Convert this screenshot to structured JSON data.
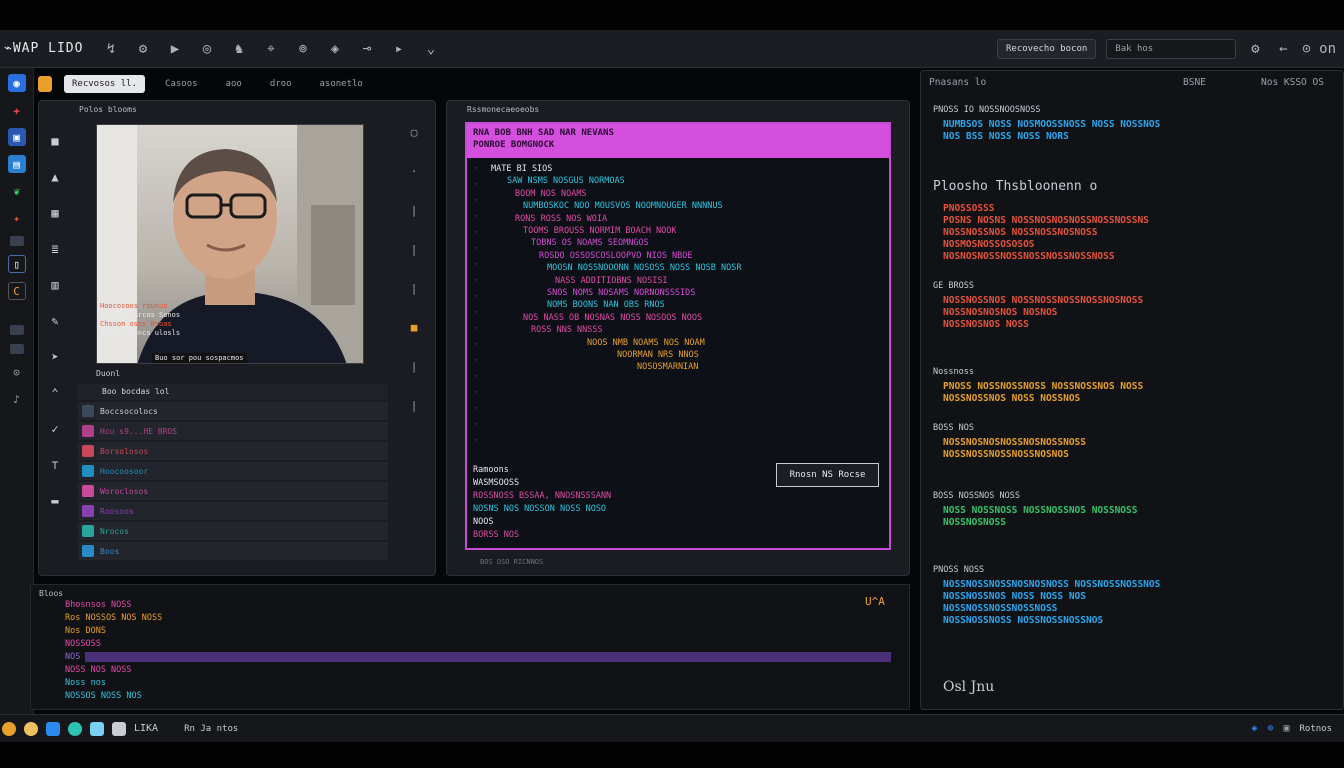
{
  "window": {
    "brand": "⌁WAP LIDO"
  },
  "menubar": {
    "tools": [
      "↯",
      "⚙",
      "▶",
      "◎",
      "♞",
      "⌖",
      "⊚",
      "◈",
      "⊸",
      "▸",
      "⌄"
    ],
    "right_button": "Recovecho bocon",
    "search_placeholder": "Bak hos",
    "right_icons": [
      "⚙",
      "←",
      "⊙ on"
    ]
  },
  "tabs": [
    {
      "label": "Recvosos ll.",
      "active": true
    },
    {
      "label": "Casoos",
      "active": false
    },
    {
      "label": "aoo",
      "active": false
    },
    {
      "label": "droo",
      "active": false
    },
    {
      "label": "asonetlo",
      "active": false
    }
  ],
  "left_panel": {
    "title": "Polos blooms",
    "caption": [
      "Hoocosoos rounuo",
      "Gnoosne Rrcos Sonos",
      "Chsson osns Bsoas",
      "Snmsos Boncs ulosls"
    ],
    "caption_bar": "Buo sor pou sospacmos",
    "status": "Duonl",
    "subheader": "Boo bocdas lol",
    "rows": [
      {
        "label": "Boccsocolocs",
        "color": "#3a4a5c"
      },
      {
        "label": "Hcu s9...HE BROS",
        "color": "#b23f8a"
      },
      {
        "label": "Borsolosos",
        "color": "#c9485a"
      },
      {
        "label": "Hoocoosoor",
        "color": "#1f8fbf"
      },
      {
        "label": "Woroclosos",
        "color": "#c94a9a"
      },
      {
        "label": "Roosoos",
        "color": "#8a3fb2"
      },
      {
        "label": "Nrocos",
        "color": "#2aa59a"
      },
      {
        "label": "Boos",
        "color": "#2a8ac9"
      }
    ]
  },
  "editor": {
    "title": "Rssmonecaeoeobs",
    "head": [
      "RNA BOB BNH SAD NAR NEVANS",
      "PONROE BOMGNOCK"
    ],
    "lines": [
      {
        "t": "MATE BI SIOS",
        "c": "#e6e8ec"
      },
      {
        "t": "SAW NSMS   NOSGUS NORMOAS",
        "c": "#2ec4e0"
      },
      {
        "t": "BOOM NOS  NOAMS",
        "c": "#e24aa8"
      },
      {
        "t": "NUMBOSKOC  NOO  MOUSVOS  NOOMNOUGER NNNNUS",
        "c": "#2ec4e0"
      },
      {
        "t": "RONS ROSS  NOS WOIA",
        "c": "#e24aa8"
      },
      {
        "t": "TOOMS BROUSS NORMIM BOACH NOOK",
        "c": "#e24aa8"
      },
      {
        "t": "TOBNS OS NOAMS SEOMNGOS",
        "c": "#d84ad8"
      },
      {
        "t": "ROSDO OSSOSCOSLOOPVO NIOS NBOE",
        "c": "#d84ad8"
      },
      {
        "t": "MOOSN NOSSNOOONN NOSOSS NOSS NOSB NOSR",
        "c": "#2ec4e0"
      },
      {
        "t": "NASS  ADDITIOBNS NOSISI",
        "c": "#e24aa8"
      },
      {
        "t": "SNOS NOMS NOSAMS NORNONSSSIDS",
        "c": "#d84ad8"
      },
      {
        "t": "NOMS BOONS NAN OBS   RNOS",
        "c": "#2ec4e0"
      },
      {
        "t": "NOS NASS OB  NOSNAS NOSS NOSOOS NOOS",
        "c": "#e24aa8"
      },
      {
        "t": "ROSS NNS NNSSS",
        "c": "#e24aa8"
      },
      {
        "t": "NOOS NMB NOAMS NOS NOAM",
        "c": "#e8a02a"
      },
      {
        "t": "NOORMAN NRS NNOS",
        "c": "#e8a02a"
      },
      {
        "t": "NOSOSMARNIAN",
        "c": "#e8a02a"
      }
    ],
    "footer": [
      "Ramoons",
      "WASMSOOSS",
      "ROSSNOSS BSSAA, NNOSNSSSANN",
      "NOSNS NOS NOSSON NOSS NOSO",
      "NOOS",
      "BORSS NOS"
    ],
    "dialog": "Rnosn NS Rocse",
    "status": "BOS OSO RICNNOS"
  },
  "right_panel": {
    "header_left": "Pnasans lo",
    "header_right": [
      "BSNE",
      "Nos KSSO OS"
    ],
    "sections": [
      {
        "title": "PNOSS  IO NOSSNOOSNOSS",
        "lines": [
          "NUMBSOS NOSS NOSMOOSSNOSS NOSS NOSSNOS",
          "NOS BSS NOSS NOSS NORS"
        ],
        "color": "#2aa8f0"
      },
      {
        "title": "Ploosho Thsbloonenn o",
        "lines": [
          "PNOSSOSSS",
          "POSNS NOSNS NOSSNOSNOSNOSSNOSSNOSSNS",
          "NOSSNOSSNOS NOSSNOSSNOSNOSS",
          "NOSMOSNOSSOSOSOS",
          "NOSNOSNOSSNOSSNOSSNOSSNOSSNOSS"
        ],
        "color": "#e8533a"
      },
      {
        "title": "GE BROSS",
        "lines": [
          "NOSSNOSSNOS NOSSNOSSNOSSNOSSNOSNOSS",
          "NOSSNOSNOSNOS NOSNOS",
          "NOSSNOSNOS NOSS"
        ],
        "color": "#e8533a"
      },
      {
        "title": "Nossnoss",
        "lines": [
          "PNOSS NOSSNOSSNOSS NOSSNOSSNOS NOSS",
          "NOSSNOSSNOS NOSS NOSSNOS"
        ],
        "color": "#e8a02a"
      },
      {
        "title": "BOSS NOS",
        "lines": [
          "NOSSNOSNOSNOSSNOSNOSSNOSS",
          "NOSSNOSSNOSSNOSSNOSNOS"
        ],
        "color": "#e8a02a"
      },
      {
        "title": "BOSS NOSSNOS NOSS",
        "lines": [
          "NOSS NOSSNOSS NOSSNOSSNOS NOSSNOSS",
          "NOSSNOSNOSS"
        ],
        "color": "#34c46a"
      },
      {
        "title": "PNOSS NOSS",
        "lines": [
          "NOSSNOSSNOSSNOSNOSNOSS NOSSNOSSNOSSNOS",
          "NOSSNOSSNOS NOSS NOSS NOS",
          "NOSSNOSSNOSSNOSSNOSS",
          "NOSSNOSSNOSS NOSSNOSSNOSSNOS"
        ],
        "color": "#2aa8f0"
      }
    ],
    "footer_text": "Osl  Jnu"
  },
  "bottom_panel": {
    "title": "Bloos",
    "lines": [
      {
        "t": "Bhosnsos NOSS",
        "c": "#e24aa8"
      },
      {
        "t": "Ros NOSSOS  NOS NOSS",
        "c": "#e8a02a"
      },
      {
        "t": "Nos DONS",
        "c": "#e8a02a"
      },
      {
        "t": "NOSSOSS",
        "c": "#e24aa8"
      },
      {
        "t": "NOS NOSSNOSS NOSSNOSSNOSSNOSSNOSS",
        "c": "#8a6ad8"
      },
      {
        "t": "NOSS NOS NOSS",
        "c": "#e24aa8"
      },
      {
        "t": "Noss nos",
        "c": "#2ec4e0"
      },
      {
        "t": "NOSSOS NOSS NOS",
        "c": "#2ec4e0"
      }
    ],
    "right_label": "U^A"
  },
  "taskbar": {
    "items": [
      "LIKA",
      "Rn Ja ntos"
    ],
    "right": [
      "Rotnos"
    ]
  }
}
